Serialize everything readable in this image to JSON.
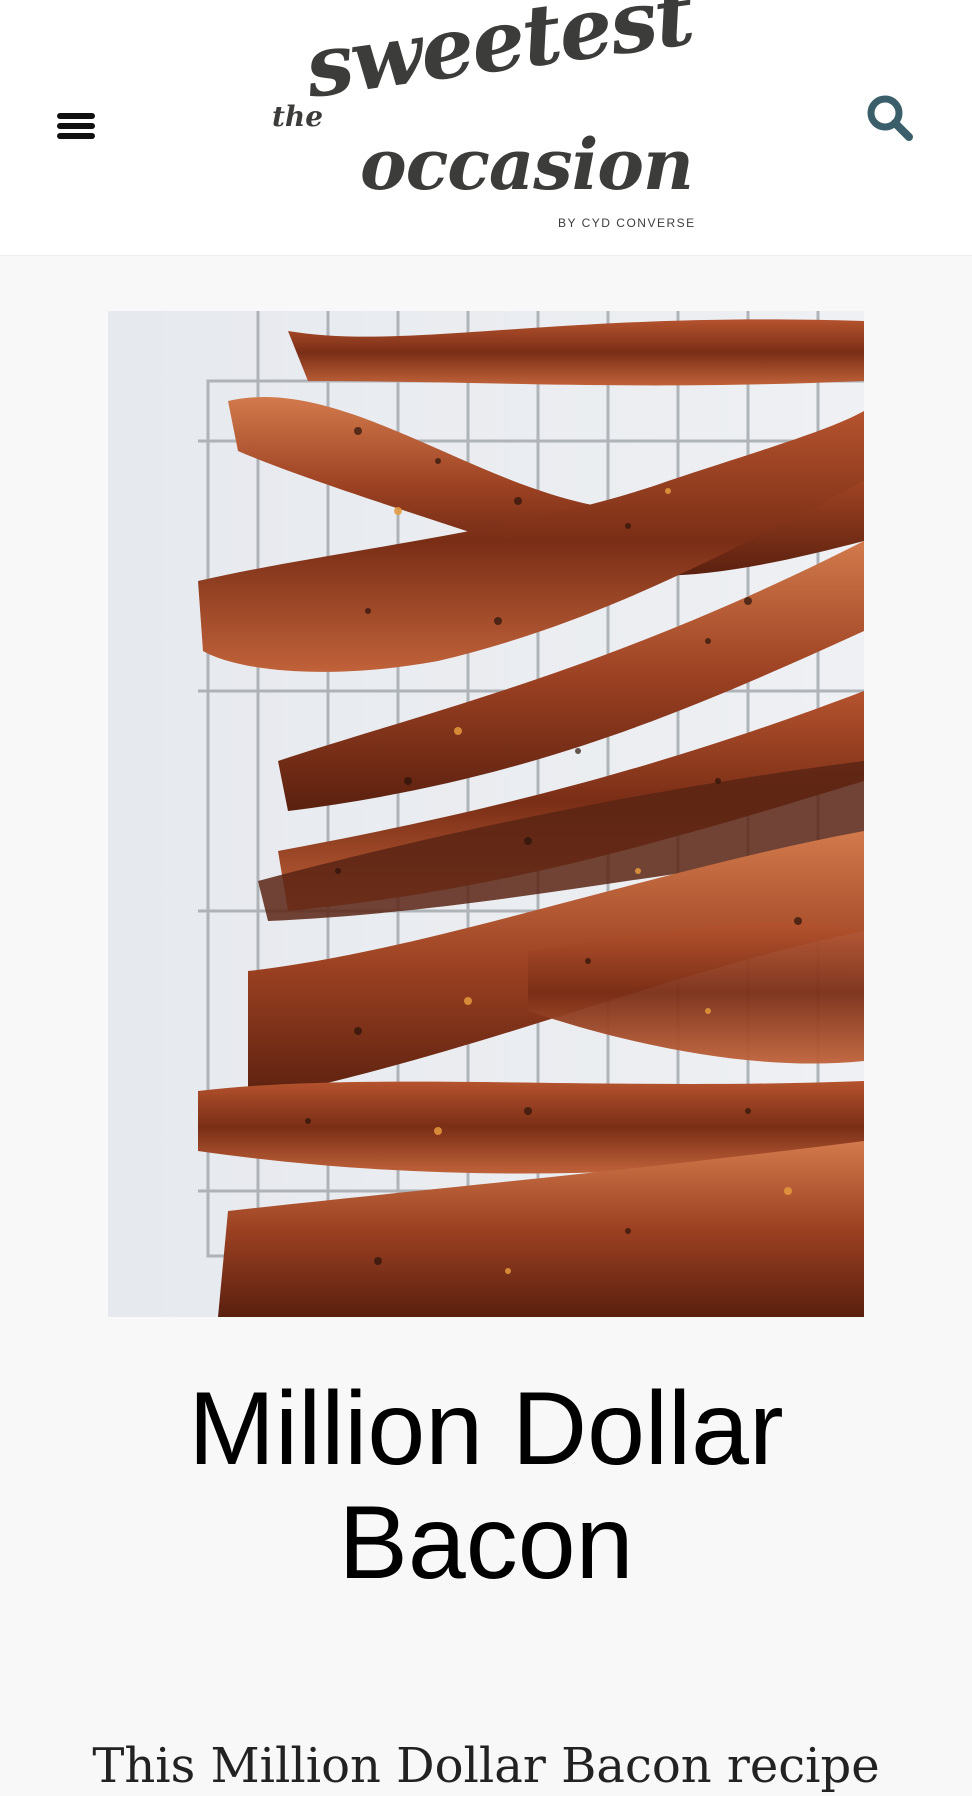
{
  "header": {
    "menu_icon": "hamburger-menu-icon",
    "search_icon": "search-icon",
    "logo": {
      "word_the": "the",
      "word_sweetest": "sweetest",
      "word_occasion": "occasion",
      "byline": "BY CYD CONVERSE"
    },
    "colors": {
      "logo": "#3c3c3a",
      "search": "#3a5f6a"
    }
  },
  "hero_image": {
    "alt": "bacon strips on a wire cooling rack"
  },
  "post": {
    "title": "Million Dollar Bacon",
    "intro": "This Million Dollar Bacon recipe"
  }
}
